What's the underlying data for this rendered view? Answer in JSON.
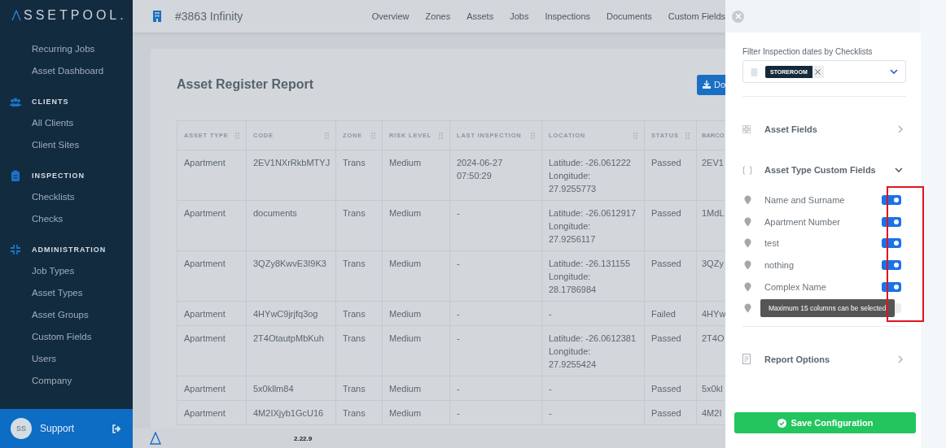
{
  "sidebar": {
    "logo": "SSETPOOL.",
    "groups": [
      {
        "items": [
          "Recurring Jobs",
          "Asset Dashboard"
        ]
      },
      {
        "kind": "clients",
        "heading": "CLIENTS",
        "items": [
          "All Clients",
          "Client Sites"
        ]
      },
      {
        "kind": "inspection",
        "heading": "INSPECTION",
        "items": [
          "Checklists",
          "Checks"
        ]
      },
      {
        "kind": "administration",
        "heading": "ADMINISTRATION",
        "items": [
          "Job Types",
          "Asset Types",
          "Asset Groups",
          "Custom Fields",
          "Users",
          "Company"
        ]
      }
    ],
    "user": {
      "initials": "SS",
      "name": "Support"
    }
  },
  "topbar": {
    "title": "#3863 Infinity",
    "nav": [
      "Overview",
      "Zones",
      "Assets",
      "Jobs",
      "Inspections",
      "Documents",
      "Custom Fields"
    ]
  },
  "report": {
    "title": "Asset Register Report",
    "download_button": "Do",
    "table": {
      "columns": [
        {
          "label": "ASSET TYPE",
          "handle": true
        },
        {
          "label": "CODE",
          "handle": true
        },
        {
          "label": "ZONE",
          "handle": true
        },
        {
          "label": "RISK LEVEL",
          "handle": true
        },
        {
          "label": "LAST INSPECTION",
          "handle": true
        },
        {
          "label": "LOCATION",
          "handle": true
        },
        {
          "label": "STATUS",
          "handle": true
        },
        {
          "label": "BARCO",
          "handle": false
        }
      ],
      "rows": [
        [
          "Apartment",
          "2EV1NXrRkbMTYJ",
          "Trans",
          "Medium",
          "2024-06-27 07:50:29",
          "Latitude: -26.061222 Longitude: 27.9255773",
          "Passed",
          "2EV1"
        ],
        [
          "Apartment",
          "documents",
          "Trans",
          "Medium",
          "-",
          "Latitude: -26.0612917 Longitude: 27.9256117",
          "Passed",
          "1MdL"
        ],
        [
          "Apartment",
          "3QZy8KwvE3I9K3",
          "Trans",
          "Medium",
          "-",
          "Latitude: -26.131155 Longitude: 28.1786984",
          "Passed",
          "3QZy"
        ],
        [
          "Apartment",
          "4HYwC9jrjfq3og",
          "Trans",
          "Medium",
          "-",
          "-",
          "Failed",
          "4HYw"
        ],
        [
          "Apartment",
          "2T4OtautpMbKuh",
          "Trans",
          "Medium",
          "-",
          "Latitude: -26.0612381 Longitude: 27.9255424",
          "Passed",
          "2T4O"
        ],
        [
          "Apartment",
          "5x0kllm84",
          "Trans",
          "Medium",
          "-",
          "-",
          "Passed",
          "5x0kl"
        ],
        [
          "Apartment",
          "4M2IXjyb1GcU16",
          "Trans",
          "Medium",
          "-",
          "-",
          "Passed",
          "4M2I"
        ]
      ]
    }
  },
  "footer": {
    "version": "2.22.9"
  },
  "panel": {
    "filter_label": "Filter Inspection dates by Checklists",
    "chips": [
      "STOREROOM"
    ],
    "sections": [
      {
        "kind": "grid",
        "label": "Asset Fields",
        "expanded": false
      },
      {
        "kind": "braces",
        "label": "Asset Type Custom Fields",
        "expanded": true,
        "fields": [
          {
            "label": "Name and Surname",
            "on": true,
            "disabled": false
          },
          {
            "label": "Apartment Number",
            "on": true,
            "disabled": false
          },
          {
            "label": "test",
            "on": true,
            "disabled": false
          },
          {
            "label": "nothing",
            "on": true,
            "disabled": false
          },
          {
            "label": "Complex Name",
            "on": true,
            "disabled": false
          },
          {
            "on": false,
            "disabled": true,
            "tooltip": "Maximum 15 columns can be selected"
          }
        ]
      },
      {
        "kind": "document",
        "label": "Report Options",
        "expanded": false
      }
    ],
    "save_button": "Save Configuration"
  }
}
